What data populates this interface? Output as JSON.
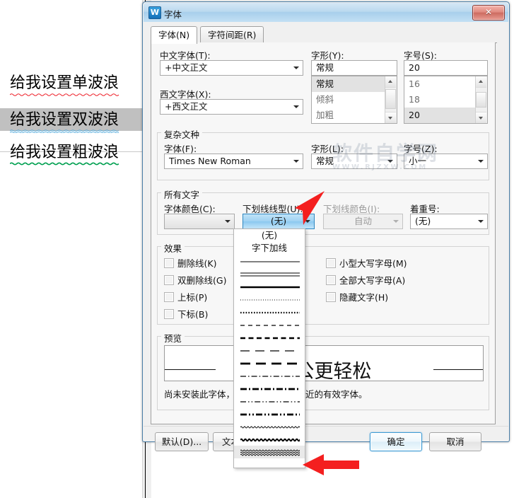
{
  "document": {
    "lines": [
      {
        "text": "给我设置单波浪",
        "color": "#ee1c25",
        "underline": "wavy-single",
        "selected": false
      },
      {
        "text": "给我设置双波浪",
        "color": "#3ca0d8",
        "underline": "wavy-double",
        "selected": true
      },
      {
        "text": "给我设置粗波浪",
        "color": "#00a050",
        "underline": "wavy-thick",
        "selected": false
      }
    ]
  },
  "dialog": {
    "title": "字体",
    "icon": "wps-logo-icon",
    "close_label": "✕",
    "tabs": [
      {
        "label": "字体(N)",
        "active": true
      },
      {
        "label": "字符间距(R)",
        "active": false
      }
    ],
    "chinese_font": {
      "label": "中文字体(T):",
      "value": "+中文正文"
    },
    "western_font": {
      "label": "西文字体(X):",
      "value": "+西文正文"
    },
    "style": {
      "label": "字形(Y):",
      "value": "常规",
      "options": [
        "常规",
        "倾斜",
        "加粗"
      ],
      "selected_index": 0
    },
    "size": {
      "label": "字号(S):",
      "value": "20",
      "options": [
        "16",
        "18",
        "20"
      ],
      "selected_index": 2
    },
    "complex_group": {
      "title": "复杂文种",
      "font": {
        "label": "字体(F):",
        "value": "Times New Roman"
      },
      "style": {
        "label": "字形(L):",
        "value": "常规"
      },
      "size": {
        "label": "字号(Z):",
        "value": "小一"
      }
    },
    "all_text_group": {
      "title": "所有文字",
      "font_color": {
        "label": "字体颜色(C):",
        "value": ""
      },
      "underline_style": {
        "label": "下划线线型(U):",
        "value": "(无)"
      },
      "underline_color": {
        "label": "下划线颜色(I):",
        "value": "自动",
        "disabled": true
      },
      "emphasis": {
        "label": "着重号:",
        "value": "(无)"
      }
    },
    "effects_group": {
      "title": "效果",
      "left": [
        {
          "label": "删除线(K)",
          "checked": false
        },
        {
          "label": "双删除线(G)",
          "checked": false
        },
        {
          "label": "上标(P)",
          "checked": false
        },
        {
          "label": "下标(B)",
          "checked": false
        }
      ],
      "right": [
        {
          "label": "小型大写字母(M)",
          "checked": false
        },
        {
          "label": "全部大写字母(A)",
          "checked": false
        },
        {
          "label": "隐藏文字(H)",
          "checked": false
        }
      ]
    },
    "preview_group": {
      "title": "预览",
      "text": "办公更轻松",
      "note": "尚未安装此字体，打印时将采用最相近的有效字体。"
    },
    "buttons": {
      "default": "默认(D)...",
      "text_effects": "文本效果",
      "ok": "确定",
      "cancel": "取消"
    }
  },
  "underline_dropdown": {
    "items": [
      {
        "name": "(无)",
        "kind": "text",
        "label": "(无)"
      },
      {
        "name": "字下加线",
        "kind": "text",
        "label": "字下加线"
      },
      {
        "name": "单实线",
        "kind": "line"
      },
      {
        "name": "双实线",
        "kind": "line"
      },
      {
        "name": "粗实线",
        "kind": "line"
      },
      {
        "name": "细点线",
        "kind": "line"
      },
      {
        "name": "粗点线",
        "kind": "line"
      },
      {
        "name": "细虚线",
        "kind": "line"
      },
      {
        "name": "粗虚线",
        "kind": "line"
      },
      {
        "name": "细长划线",
        "kind": "line"
      },
      {
        "name": "粗长划线",
        "kind": "line"
      },
      {
        "name": "细点划线",
        "kind": "line"
      },
      {
        "name": "粗点划线",
        "kind": "line"
      },
      {
        "name": "细双点划线",
        "kind": "line"
      },
      {
        "name": "粗双点划线",
        "kind": "line"
      },
      {
        "name": "细波浪线",
        "kind": "wave"
      },
      {
        "name": "粗波浪线",
        "kind": "wave"
      },
      {
        "name": "三波浪线",
        "kind": "wave"
      }
    ],
    "selected_index": 17
  },
  "watermark": {
    "line1": "软件自学网",
    "line2": "WWW.RJZXW.COM"
  },
  "colors": {
    "accent": "#3c9ad4",
    "title_gradient_top": "#d5e7f5",
    "close_red": "#cd6b60",
    "highlight_combo": "#9fd2f2"
  }
}
